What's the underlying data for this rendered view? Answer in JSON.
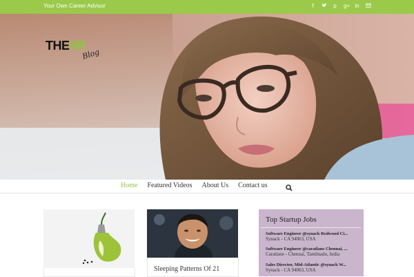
{
  "topbar": {
    "tagline": "Your Own Career Advisor",
    "social_icons": [
      "facebook-icon",
      "twitter-icon",
      "pinterest-icon",
      "google-plus-icon",
      "linkedin-icon",
      "email-icon"
    ],
    "background_color": "#9bc94a"
  },
  "logo": {
    "the": "THE",
    "hr": "HR",
    "blog": "Blog",
    "accent_color": "#8cc63f"
  },
  "nav": {
    "items": [
      {
        "label": "Home",
        "active": true
      },
      {
        "label": "Featured Videos",
        "active": false
      },
      {
        "label": "About Us",
        "active": false
      },
      {
        "label": "Contact us",
        "active": false
      }
    ],
    "search_icon": "search-icon",
    "active_color": "#8cc63f"
  },
  "posts": [
    {
      "title": "",
      "image": "lightbulb-pear-image"
    },
    {
      "title": "Sleeping Patterns Of 21",
      "image": "smiling-man-portrait-image"
    }
  ],
  "jobs": {
    "title": "Top Startup Jobs",
    "items": [
      {
        "title": "Software Engineer @synack Redwood Ci...",
        "location": "Synack - CA 94063, USA"
      },
      {
        "title": "Software Engineer @caratlane Chennai, ...",
        "location": "Caratlane - Chennai, Tamilnadu, India"
      },
      {
        "title": "Sales Director, Mid-Atlantic @synack W...",
        "location": "Synack - CA 94063, USA"
      }
    ],
    "background_color": "#c9b5cc"
  }
}
